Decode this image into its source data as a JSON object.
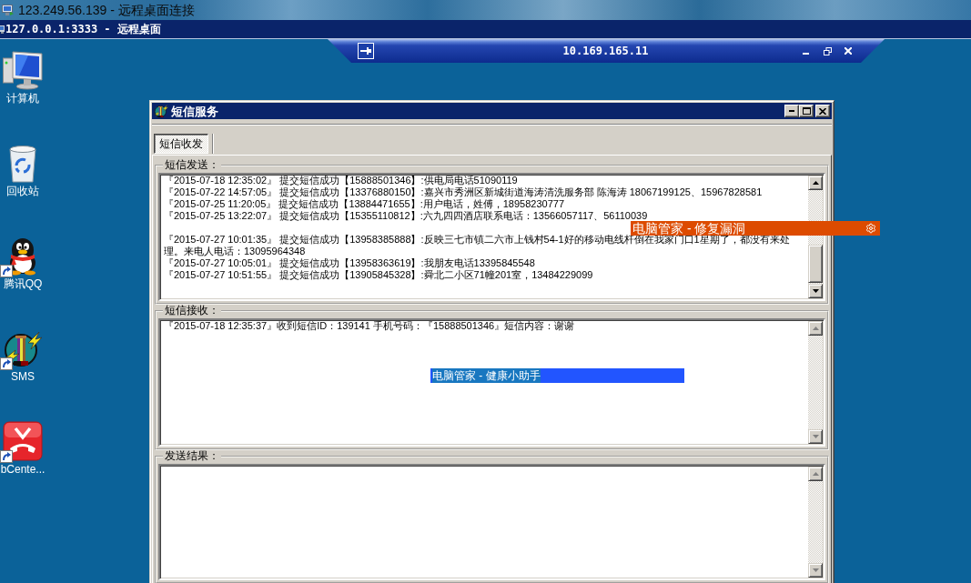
{
  "client_window": {
    "title": "123.249.56.139 - 远程桌面连接"
  },
  "session_window": {
    "title": "127.0.0.1:3333 - 远程桌面"
  },
  "connection_bar": {
    "host": "10.169.165.11"
  },
  "desktop_icons": [
    {
      "label": "计算机",
      "kind": "computer",
      "shortcut": false
    },
    {
      "label": "回收站",
      "kind": "recycle_bin",
      "shortcut": false
    },
    {
      "label": "腾讯QQ",
      "kind": "penguin",
      "shortcut": true
    },
    {
      "label": "SMS",
      "kind": "signal",
      "shortcut": true
    },
    {
      "label": "bCente...",
      "kind": "phone",
      "shortcut": true
    }
  ],
  "sms_window": {
    "title": "短信服务",
    "tabs": [
      {
        "label": "短信收发",
        "selected": true
      }
    ],
    "groups": [
      {
        "label": "短信发送：",
        "scrollable": true,
        "entries": [
          {
            "text": "『2015-07-18 12:35:02』 提交短信成功【15888501346】:供电局电话51090119",
            "blank_line_before": false
          },
          {
            "text": "『2015-07-22 14:57:05』 提交短信成功【13376880150】:嘉兴市秀洲区新城街道海涛清洗服务部 陈海涛 18067199125、15967828581",
            "blank_line_before": false
          },
          {
            "text": "『2015-07-25 11:20:05』 提交短信成功【13884471655】:用户电话，姓傅，18958230777",
            "blank_line_before": false
          },
          {
            "text": "『2015-07-25 13:22:07』 提交短信成功【15355110812】:六九四四酒店联系电话：13566057117、56110039",
            "blank_line_before": false
          },
          {
            "text": "『2015-07-27 10:01:35』 提交短信成功【13958385888】:反映三七市镇二六市上钱村54-1好的移动电线杆倒在我家门口1星期了，都没有来处理。来电人电话：13095964348",
            "blank_line_before": true
          },
          {
            "text": "『2015-07-27 10:05:01』 提交短信成功【13958363619】:我朋友电话13395845548",
            "blank_line_before": false
          },
          {
            "text": "『2015-07-27 10:51:55』 提交短信成功【13905845328】:舜北二小区71幢201室，13484229099",
            "blank_line_before": false
          }
        ]
      },
      {
        "label": "短信接收：",
        "scrollable": false,
        "entries": [
          {
            "text": "『2015-07-18 12:35:37』收到短信ID：139141 手机号码：『15888501346』短信内容：谢谢",
            "blank_line_before": false
          }
        ]
      },
      {
        "label": "发送结果：",
        "scrollable": false
      }
    ]
  },
  "notifications": [
    {
      "kind": "repair",
      "text": "电脑管家 - 修复漏洞"
    },
    {
      "kind": "health",
      "text": "电脑管家 - 健康小助手"
    }
  ]
}
